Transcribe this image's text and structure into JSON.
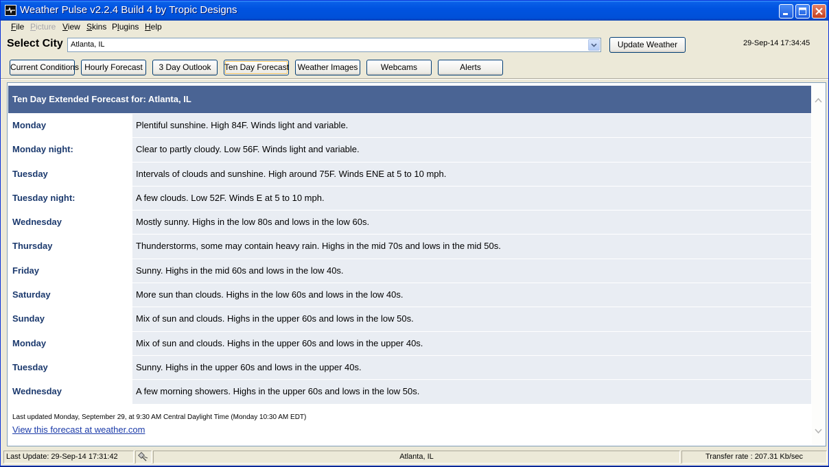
{
  "window": {
    "title": "Weather Pulse v2.2.4 Build 4 by Tropic Designs"
  },
  "menu": [
    {
      "label": "File",
      "underline": "F",
      "rest": "ile",
      "enabled": true
    },
    {
      "label": "Picture",
      "underline": "P",
      "rest": "icture",
      "enabled": false
    },
    {
      "label": "View",
      "underline": "V",
      "rest": "iew",
      "enabled": true
    },
    {
      "label": "Skins",
      "underline": "S",
      "rest": "kins",
      "enabled": true
    },
    {
      "label": "Plugins",
      "underline": "l",
      "rest": "ugins",
      "enabled": true
    },
    {
      "label": "Help",
      "underline": "H",
      "rest": "elp",
      "enabled": true
    }
  ],
  "city": {
    "label": "Select City",
    "value": "Atlanta, IL",
    "update_button": "Update Weather",
    "clock": "29-Sep-14 17:34:45"
  },
  "tabs": [
    {
      "label": "Current Conditions",
      "active": false
    },
    {
      "label": "Hourly Forecast",
      "active": false
    },
    {
      "label": "3 Day Outlook",
      "active": false
    },
    {
      "label": "Ten Day Forecast",
      "active": true
    },
    {
      "label": "Weather Images",
      "active": false
    },
    {
      "label": "Webcams",
      "active": false
    },
    {
      "label": "Alerts",
      "active": false
    }
  ],
  "forecast": {
    "header": "Ten Day Extended Forecast for: Atlanta, IL",
    "rows": [
      {
        "day": "Monday",
        "text": "Plentiful sunshine. High 84F. Winds light and variable."
      },
      {
        "day": "Monday night:",
        "text": "Clear to partly cloudy. Low 56F. Winds light and variable."
      },
      {
        "day": "Tuesday",
        "text": "Intervals of clouds and sunshine. High around 75F. Winds ENE at 5 to 10 mph."
      },
      {
        "day": "Tuesday night:",
        "text": "A few clouds. Low 52F. Winds E at 5 to 10 mph."
      },
      {
        "day": "Wednesday",
        "text": "Mostly sunny. Highs in the low 80s and lows in the low 60s."
      },
      {
        "day": "Thursday",
        "text": "Thunderstorms, some may contain heavy rain. Highs in the mid 70s and lows in the mid 50s."
      },
      {
        "day": "Friday",
        "text": "Sunny. Highs in the mid 60s and lows in the low 40s."
      },
      {
        "day": "Saturday",
        "text": "More sun than clouds. Highs in the low 60s and lows in the low 40s."
      },
      {
        "day": "Sunday",
        "text": "Mix of sun and clouds. Highs in the upper 60s and lows in the low 50s."
      },
      {
        "day": "Monday",
        "text": "Mix of sun and clouds. Highs in the upper 60s and lows in the upper 40s."
      },
      {
        "day": "Tuesday",
        "text": "Sunny. Highs in the upper 60s and lows in the upper 40s."
      },
      {
        "day": "Wednesday",
        "text": "A few morning showers. Highs in the upper 60s and lows in the low 50s."
      }
    ],
    "last_updated": "Last updated Monday, September 29, at 9:30 AM Central Daylight Time (Monday 10:30 AM EDT)",
    "link": "View this forecast at weather.com"
  },
  "status": {
    "last_update": "Last Update: 29-Sep-14 17:31:42",
    "icon": "satellite-icon",
    "city": "Atlanta, IL",
    "transfer_rate": "Transfer rate : 207.31 Kb/sec"
  },
  "colors": {
    "header_bg": "#4a6494",
    "day_text": "#1c3a6e",
    "row_bg": "#e9edf3",
    "link": "#1a3aa8"
  }
}
